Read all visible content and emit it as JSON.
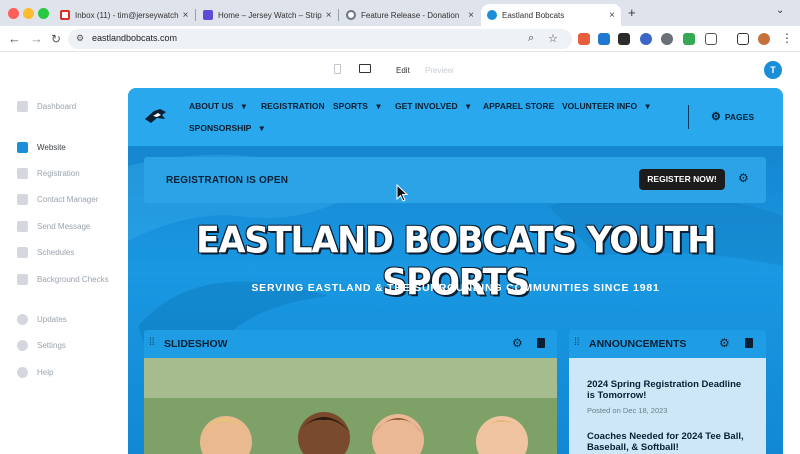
{
  "browser": {
    "tabs": [
      {
        "label": "Inbox (11) - tim@jerseywatch",
        "favicon_color": "#d93025"
      },
      {
        "label": "Home – Jersey Watch – Strip",
        "favicon_color": "#5b4bd6"
      },
      {
        "label": "Feature Release - Donation",
        "favicon_color": "#6c7480"
      },
      {
        "label": "Eastland Bobcats",
        "favicon_color": "#1a8ed8"
      }
    ],
    "new_tab_symbol": "+",
    "url": "eastlandbobcats.com",
    "profile_initial": "T"
  },
  "editor": {
    "back_symbol": "‹",
    "modes": {
      "edit": "Edit",
      "preview": "Preview"
    },
    "user_initial": "T"
  },
  "sidebar": {
    "items": [
      {
        "label": "Dashboard",
        "active": false
      },
      {
        "label": "Website",
        "active": true
      },
      {
        "label": "Registration",
        "active": false
      },
      {
        "label": "Contact Manager",
        "active": false
      },
      {
        "label": "Send Message",
        "active": false
      },
      {
        "label": "Schedules",
        "active": false
      },
      {
        "label": "Background Checks",
        "active": false
      },
      {
        "label": "Updates",
        "active": false
      },
      {
        "label": "Settings",
        "active": false
      },
      {
        "label": "Help",
        "active": false
      }
    ]
  },
  "site": {
    "nav": [
      {
        "label": "ABOUT US",
        "caret": "▾"
      },
      {
        "label": "REGISTRATION",
        "caret": ""
      },
      {
        "label": "SPORTS",
        "caret": "▾"
      },
      {
        "label": "GET INVOLVED",
        "caret": "▾"
      },
      {
        "label": "APPAREL STORE",
        "caret": ""
      },
      {
        "label": "VOLUNTEER INFO",
        "caret": "▾"
      },
      {
        "label": "SPONSORSHIP",
        "caret": "▾"
      }
    ],
    "pages_label": "PAGES",
    "banner": {
      "text": "REGISTRATION IS OPEN",
      "button": "REGISTER NOW!"
    },
    "hero": {
      "title": "EASTLAND BOBCATS YOUTH SPORTS",
      "subtitle": "SERVING EASTLAND & THE SURROUNDING COMMUNITIES SINCE 1981"
    },
    "slideshow": {
      "title": "SLIDESHOW"
    },
    "announcements": {
      "title": "ANNOUNCEMENTS",
      "items": [
        {
          "title": "2024 Spring Registration Deadline is Tomorrow!",
          "date": "Posted on Dec 18, 2023"
        },
        {
          "title": "Coaches Needed for 2024 Tee Ball, Baseball, & Softball!",
          "date": ""
        }
      ]
    }
  },
  "colors": {
    "accent": "#1a8ed8",
    "site_blue": "#2aa8ee",
    "dark": "#1c1c1c"
  }
}
